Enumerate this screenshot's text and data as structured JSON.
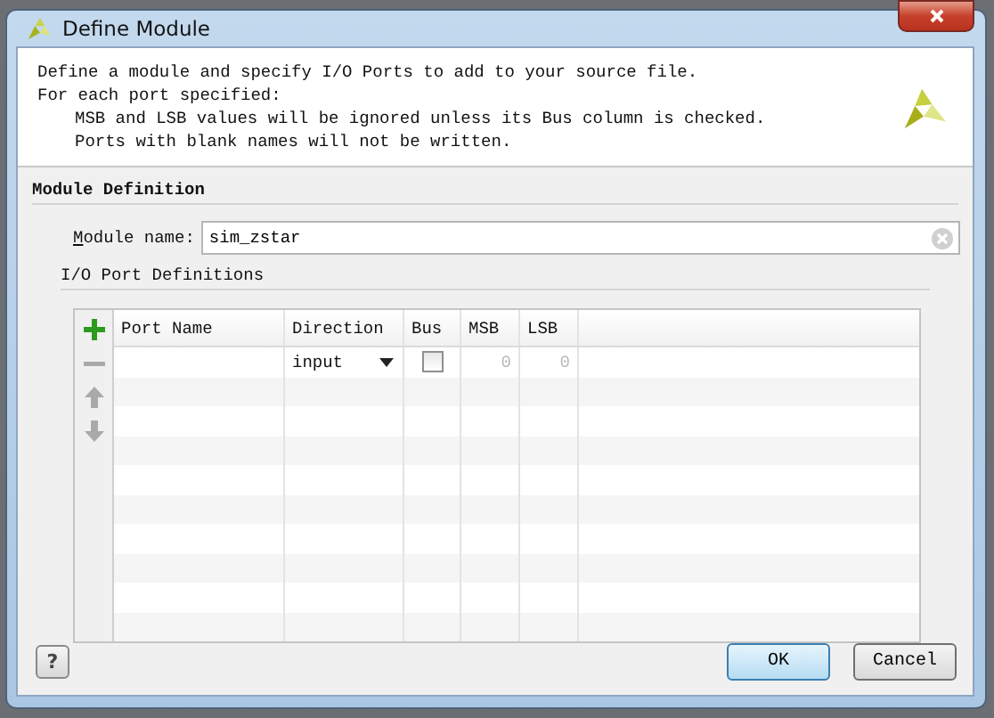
{
  "window": {
    "title": "Define Module"
  },
  "description": [
    {
      "text": "Define a module and specify I/O Ports to add to your source file."
    },
    {
      "text": "For each port specified:",
      "children": [
        {
          "text": "MSB and LSB values will be ignored unless its Bus column is checked."
        },
        {
          "text": "Ports with blank names will not be written."
        }
      ]
    }
  ],
  "module_definition": {
    "heading": "Module Definition",
    "name_label": "Module name:",
    "name_value": "sim_zstar"
  },
  "ports": {
    "heading": "I/O Port Definitions",
    "tool_buttons": [
      {
        "kind": "add",
        "disabled": false
      },
      {
        "kind": "remove",
        "disabled": true
      },
      {
        "kind": "up",
        "disabled": true
      },
      {
        "kind": "down",
        "disabled": true
      }
    ],
    "columns": [
      "Port Name",
      "Direction",
      "Bus",
      "MSB",
      "LSB"
    ],
    "rows": [
      {
        "direction": "input",
        "bus": false,
        "msb": "0",
        "lsb": "0"
      }
    ]
  },
  "help_button": "?",
  "buttons": [
    {
      "label": "OK",
      "default": true
    },
    {
      "label": "Cancel",
      "default": false
    }
  ]
}
